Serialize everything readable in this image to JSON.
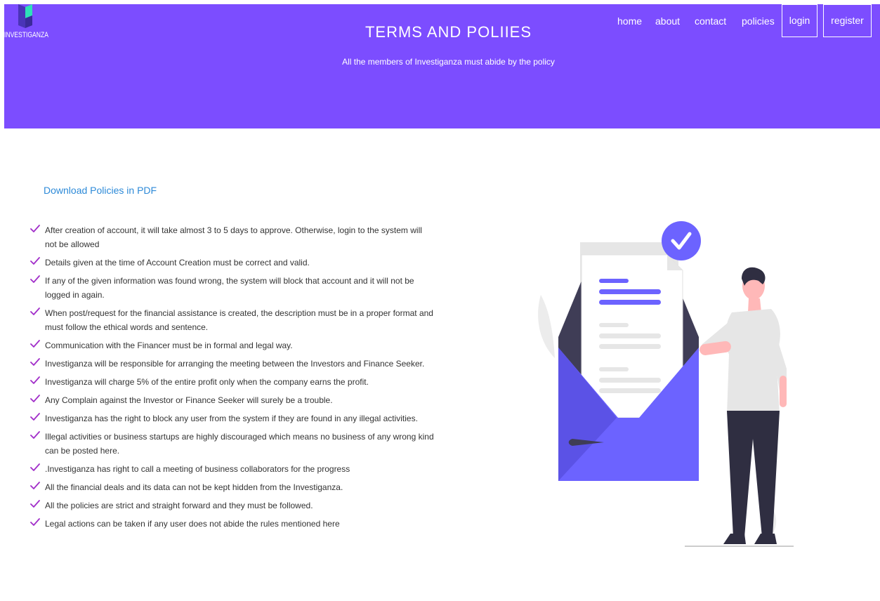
{
  "brand": {
    "name": "INVESTIGANZA"
  },
  "header": {
    "title": "TERMS AND POLIIES",
    "subtitle": "All the members of Investiganza must abide by the policy"
  },
  "nav": {
    "home": "home",
    "about": "about",
    "contact": "contact",
    "policies": "policies",
    "login": "login",
    "register": "register"
  },
  "content": {
    "download_label": "Download Policies in PDF",
    "policies": [
      "After creation of account, it will take almost 3 to 5 days to approve. Otherwise, login to the system will not be allowed",
      "Details given at the time of Account Creation must be correct and valid.",
      "If any of the given information was found wrong, the system will block that account and it will not be logged in again.",
      "When post/request for the financial assistance is created, the description must be in a proper format and must follow the ethical words and sentence.",
      "Communication with the Financer must be in formal and legal way.",
      "Investiganza will be responsible for arranging the meeting between the Investors and Finance Seeker.",
      "Investiganza will charge 5% of the entire profit only when the company earns the profit.",
      "Any Complain against the Investor or Finance Seeker will surely be a trouble.",
      "Investiganza has the right to block any user from the system if they are found in any illegal activities.",
      "Illegal activities or business startups are highly discouraged which means no business of any wrong kind can be posted here.",
      ".Investiganza has right to call a meeting of business collaborators for the progress",
      "All the financial deals and its data can not be kept hidden from the Investiganza.",
      "All the policies are strict and straight forward and they must be followed.",
      "Legal actions can be taken if any user does not abide the rules mentioned here"
    ]
  },
  "colors": {
    "header_bg": "#7c4dff",
    "accent": "#6c63ff",
    "check": "#a12ec9",
    "link": "#2d8ad8"
  },
  "icons": {
    "list_bullet": "check-icon",
    "illustration_badge": "check-circle-icon"
  }
}
